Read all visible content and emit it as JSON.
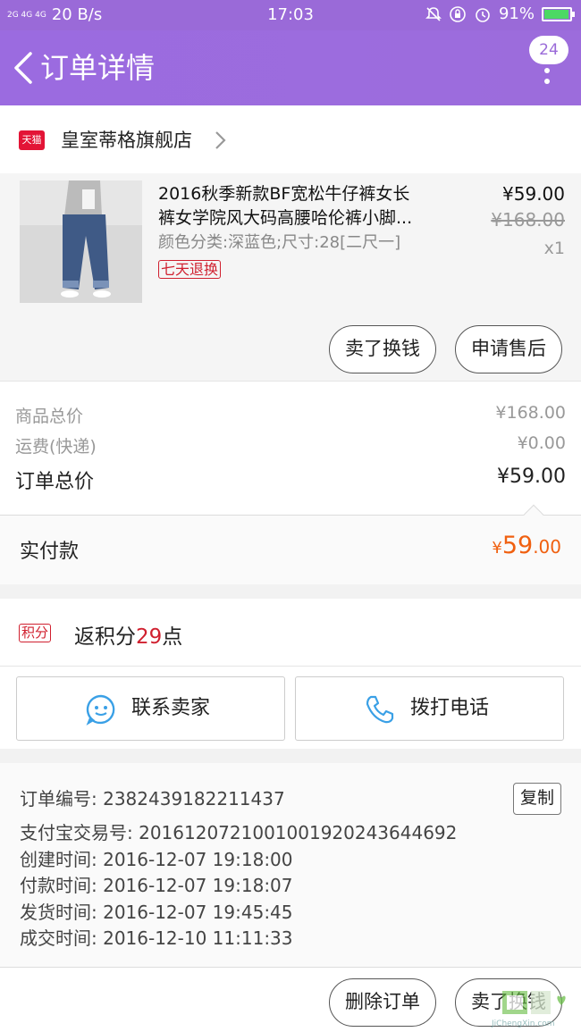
{
  "status_bar": {
    "signal": "2G 4G 4G",
    "speed": "20 B/s",
    "time": "17:03",
    "battery": "91%",
    "battery_level": 0.91
  },
  "header": {
    "title": "订单详情",
    "badge": "24"
  },
  "store": {
    "badge": "天猫",
    "name": "皇室蒂格旗舰店"
  },
  "item": {
    "title_line1": "2016秋季新款BF宽松牛仔裤女长",
    "title_line2": "裤女学院风大码高腰哈伦裤小脚...",
    "sku": "颜色分类:深蓝色;尺寸:28[二尺一]",
    "tag": "七天退换",
    "price": "¥59.00",
    "original_price": "¥168.00",
    "quantity": "x1",
    "sell_button": "卖了换钱",
    "service_button": "申请售后"
  },
  "summary": {
    "goods_label": "商品总价",
    "goods_value": "¥168.00",
    "shipping_label": "运费(快递)",
    "shipping_value": "¥0.00",
    "total_label": "订单总价",
    "total_value": "¥59.00"
  },
  "paid": {
    "label": "实付款",
    "currency": "¥",
    "integer": "59",
    "decimal": ".00"
  },
  "points": {
    "badge": "积分",
    "prefix": "返积分",
    "value": "29",
    "suffix": "点"
  },
  "contact": {
    "seller_label": "联系卖家",
    "phone_label": "拨打电话"
  },
  "order_info": {
    "order_no": "订单编号: 2382439182211437",
    "alipay_no": "支付宝交易号: 2016120721001001920243644692",
    "created": "创建时间: 2016-12-07 19:18:00",
    "paid_time": "付款时间: 2016-12-07 19:18:07",
    "shipped": "发货时间: 2016-12-07 19:45:45",
    "completed": "成交时间: 2016-12-10 11:11:33",
    "copy_label": "复制"
  },
  "footer": {
    "delete_label": "删除订单",
    "sell_label": "卖了换钱",
    "watermark": "JiChengXin.com"
  },
  "colors": {
    "header": "#9b6be0",
    "tmall_red": "#e31436",
    "paid_orange": "#f06010",
    "points_red": "#d0202f",
    "icon_blue": "#3aa0e6"
  }
}
